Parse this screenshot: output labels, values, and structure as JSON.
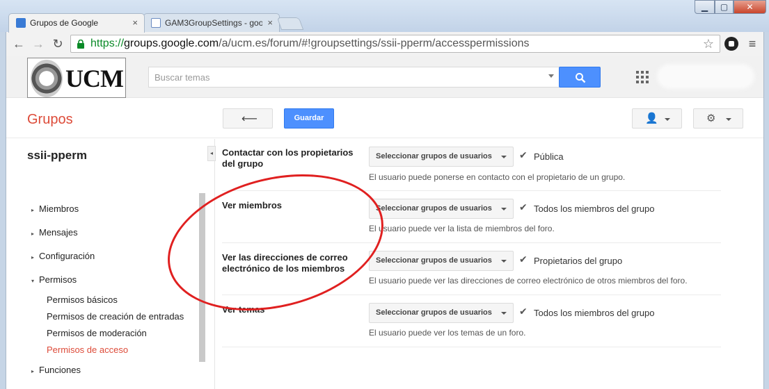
{
  "browser": {
    "tabs": [
      {
        "label": "Grupos de Google",
        "active": true
      },
      {
        "label": "GAM3GroupSettings - goo",
        "active": false
      }
    ],
    "url": {
      "scheme": "https://",
      "host": "groups.google.com",
      "path": "/a/ucm.es/forum/#!groupsettings/ssii-pperm/accesspermissions"
    }
  },
  "header": {
    "logo_text": "UCM",
    "search_placeholder": "Buscar temas"
  },
  "subbar": {
    "product": "Grupos",
    "save_label": "Guardar"
  },
  "sidebar": {
    "group_name": "ssii-pperm",
    "items": [
      {
        "label": "Miembros",
        "expanded": false
      },
      {
        "label": "Mensajes",
        "expanded": false
      },
      {
        "label": "Configuración",
        "expanded": false
      },
      {
        "label": "Permisos",
        "expanded": true
      },
      {
        "label": "Funciones",
        "expanded": false
      }
    ],
    "subitems": [
      {
        "label": "Permisos básicos"
      },
      {
        "label": "Permisos de creación de entradas"
      },
      {
        "label": "Permisos de moderación"
      },
      {
        "label": "Permisos de acceso",
        "selected": true
      }
    ]
  },
  "permissions": [
    {
      "title": "Contactar con los propietarios del grupo",
      "select_label": "Seleccionar grupos de usuarios",
      "value": "Pública",
      "description": "El usuario puede ponerse en contacto con el propietario de un grupo."
    },
    {
      "title": "Ver miembros",
      "select_label": "Seleccionar grupos de usuarios",
      "value": "Todos los miembros del grupo",
      "description": "El usuario puede ver la lista de miembros del foro."
    },
    {
      "title": "Ver las direcciones de correo electrónico de los miembros",
      "select_label": "Seleccionar grupos de usuarios",
      "value": "Propietarios del grupo",
      "description": "El usuario puede ver las direcciones de correo electrónico de otros miembros del foro."
    },
    {
      "title": "Ver temas",
      "select_label": "Seleccionar grupos de usuarios",
      "value": "Todos los miembros del grupo",
      "description": "El usuario puede ver los temas de un foro."
    }
  ],
  "colors": {
    "accent_red": "#dd4b39",
    "primary_blue": "#4d90fe",
    "annotation_red": "#e02020"
  }
}
